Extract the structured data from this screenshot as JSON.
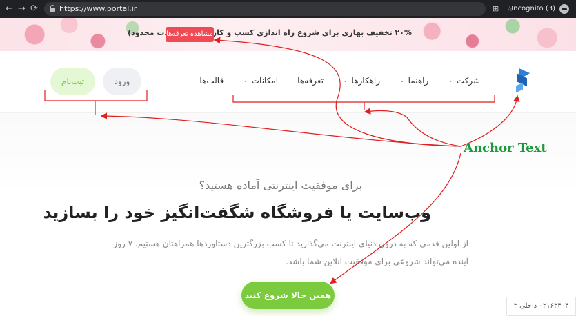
{
  "browser": {
    "back_icon": "←",
    "forward_icon": "→",
    "reload_icon": "⟳",
    "url": "https://www.portal.ir",
    "translate_icon": "⊞",
    "star_icon": "☆",
    "incognito_label": "Incognito (3)"
  },
  "promo": {
    "text": "۲۰% تخفیف بهاری برای شروع راه اندازی کسب و کار اینترنتی (مدت محدود)",
    "button_label": "مشاهده تعرفه‌ها",
    "button_color": "#f04b55"
  },
  "header": {
    "nav": [
      {
        "label": "قالب‌ها",
        "dropdown": false
      },
      {
        "label": "امکانات",
        "dropdown": true
      },
      {
        "label": "تعرفه‌ها",
        "dropdown": false
      },
      {
        "label": "راهکارها",
        "dropdown": true
      },
      {
        "label": "راهنما",
        "dropdown": true
      },
      {
        "label": "شرکت",
        "dropdown": true
      }
    ],
    "chevron_icon": "⌄",
    "login_label": "ورود",
    "signup_label": "ثبت‌نام"
  },
  "hero": {
    "subtitle": "برای موفقیت اینترنتی آماده هستید؟",
    "title": "وب‌سایت یا فروشگاه شگفت‌انگیز خود را بسازید",
    "description": "از اولین قدمی که به درون دنیای اینترنت می‌گذارید تا کسب بزرگترین دستاوردها همراهتان هستیم. ۷ روز آینده می‌تواند شروعی برای موفقیت آنلاین شما باشد.",
    "cta_label": "همین حالا شروع کنید",
    "cta_color": "#7cca3e",
    "phone": "۰۲۱۶۳۴۰۴ داخلی ۲"
  },
  "annotation": {
    "label": "Anchor Text",
    "label_color": "#1a9a3b",
    "arrow_color": "#e01f1f"
  }
}
